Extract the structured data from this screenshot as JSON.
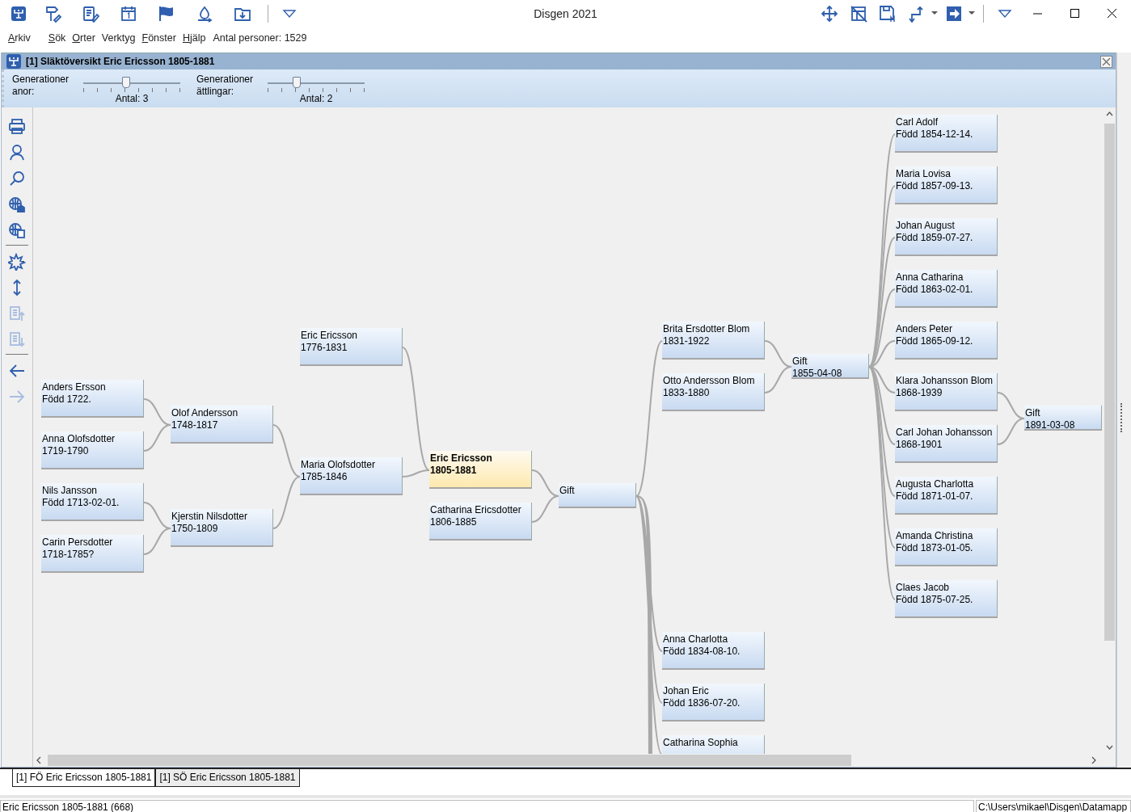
{
  "window": {
    "title": "Disgen 2021"
  },
  "menu": [
    {
      "label": "Arkiv",
      "mnemonic": true
    },
    {
      "label": "Sök",
      "mnemonic": true
    },
    {
      "label": "Orter",
      "mnemonic": true
    },
    {
      "label": "Verktyg",
      "mnemonic": false
    },
    {
      "label": "Fönster",
      "mnemonic": true
    },
    {
      "label": "Hjälp",
      "mnemonic": true
    }
  ],
  "person_count": "Antal personer: 1529",
  "document": {
    "title": "[1] Släktöversikt Eric Ericsson 1805-1881"
  },
  "sliders": [
    {
      "label": "Generationer anor:",
      "level": 0.43,
      "reading": "Antal: 3"
    },
    {
      "label": "Generationer ättlingar:",
      "level": 0.29,
      "reading": "Antal: 2"
    }
  ],
  "side_toolbar": [
    [
      {
        "kind": "print",
        "disabled": false
      },
      {
        "kind": "person",
        "disabled": false
      },
      {
        "kind": "search",
        "disabled": false
      },
      {
        "kind": "globe-home",
        "disabled": false
      },
      {
        "kind": "globe-card",
        "disabled": false
      }
    ],
    [
      {
        "kind": "star",
        "disabled": false
      },
      {
        "kind": "updown",
        "disabled": false
      },
      {
        "kind": "doc-up",
        "disabled": true
      },
      {
        "kind": "doc-down",
        "disabled": true
      }
    ],
    [
      {
        "kind": "back",
        "disabled": false
      },
      {
        "kind": "forward",
        "disabled": true
      }
    ]
  ],
  "tree": [
    {
      "kind": "person",
      "name": "Anders Ersson",
      "dates": "Född 1722.",
      "selected": false
    },
    {
      "kind": "person",
      "name": "Anna Olofsdotter",
      "dates": "1719-1790",
      "selected": false
    },
    {
      "kind": "person",
      "name": "Nils Jansson",
      "dates": "Född 1713-02-01.",
      "selected": false
    },
    {
      "kind": "person",
      "name": "Carin Persdotter",
      "dates": "1718-1785?",
      "selected": false
    },
    {
      "kind": "person",
      "name": "Olof Andersson",
      "dates": "1748-1817",
      "selected": false
    },
    {
      "kind": "person",
      "name": "Kjerstin Nilsdotter",
      "dates": "1750-1809",
      "selected": false
    },
    {
      "kind": "person",
      "name": "Eric Ericsson",
      "dates": "1776-1831",
      "selected": false
    },
    {
      "kind": "person",
      "name": "Maria Olofsdotter",
      "dates": "1785-1846",
      "selected": false
    },
    {
      "kind": "person",
      "name": "Eric Ericsson",
      "dates": "1805-1881",
      "selected": true
    },
    {
      "kind": "person",
      "name": "Catharina Ericsdotter",
      "dates": "1806-1885",
      "selected": false
    },
    {
      "kind": "marriage",
      "label": "Gift"
    },
    {
      "kind": "person",
      "name": "Brita Ersdotter Blom",
      "dates": "1831-1922",
      "selected": false
    },
    {
      "kind": "person",
      "name": "Otto Andersson Blom",
      "dates": "1833-1880",
      "selected": false
    },
    {
      "kind": "marriage",
      "label": "Gift",
      "date": "1855-04-08"
    },
    {
      "kind": "person",
      "name": "Carl Adolf",
      "dates": "Född 1854-12-14.",
      "selected": false
    },
    {
      "kind": "person",
      "name": "Maria Lovisa",
      "dates": "Född 1857-09-13.",
      "selected": false
    },
    {
      "kind": "person",
      "name": "Johan August",
      "dates": "Född 1859-07-27.",
      "selected": false
    },
    {
      "kind": "person",
      "name": "Anna Catharina",
      "dates": "Född 1863-02-01.",
      "selected": false
    },
    {
      "kind": "person",
      "name": "Anders Peter",
      "dates": "Född 1865-09-12.",
      "selected": false
    },
    {
      "kind": "person",
      "name": "Klara Johansson Blom",
      "dates": "1868-1939",
      "selected": false
    },
    {
      "kind": "person",
      "name": "Carl Johan Johansson",
      "dates": "1868-1901",
      "selected": false
    },
    {
      "kind": "person",
      "name": "Augusta Charlotta",
      "dates": "Född 1871-01-07.",
      "selected": false
    },
    {
      "kind": "person",
      "name": "Amanda Christina",
      "dates": "Född 1873-01-05.",
      "selected": false
    },
    {
      "kind": "person",
      "name": "Claes Jacob",
      "dates": "Född 1875-07-25.",
      "selected": false
    },
    {
      "kind": "marriage",
      "label": "Gift",
      "date": "1891-03-08"
    },
    {
      "kind": "person",
      "name": "Anna Charlotta",
      "dates": "Född 1834-08-10.",
      "selected": false
    },
    {
      "kind": "person",
      "name": "Johan Eric",
      "dates": "Född 1836-07-20.",
      "selected": false
    },
    {
      "kind": "person",
      "name": "Catharina Sophia",
      "selected": false
    }
  ],
  "tabs": [
    {
      "label": "[1] FÖ Eric Ericsson 1805-1881",
      "selected": true
    },
    {
      "label": "[1] SÖ Eric Ericsson 1805-1881",
      "selected": false
    }
  ],
  "status_bar": {
    "text": "Eric Ericsson 1805-1881 (668)",
    "path": "C:\\Users\\mikael\\Disgen\\Datamapp"
  }
}
